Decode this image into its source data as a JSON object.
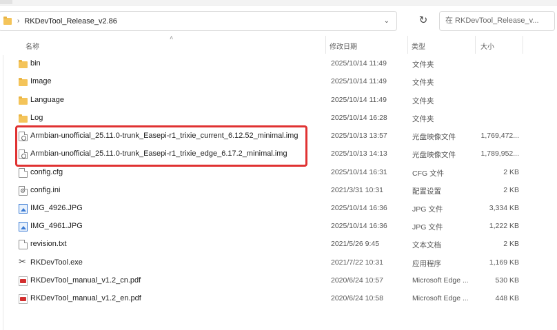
{
  "address": {
    "path": "RKDevTool_Release_v2.86",
    "search_placeholder": "在 RKDevTool_Release_v..."
  },
  "columns": {
    "name": "名称",
    "date": "修改日期",
    "type": "类型",
    "size": "大小"
  },
  "files": [
    {
      "name": "bin",
      "date": "2025/10/14 11:49",
      "type": "文件夹",
      "size": "",
      "icon": "folder-icon"
    },
    {
      "name": "Image",
      "date": "2025/10/14 11:49",
      "type": "文件夹",
      "size": "",
      "icon": "folder-icon"
    },
    {
      "name": "Language",
      "date": "2025/10/14 11:49",
      "type": "文件夹",
      "size": "",
      "icon": "folder-icon"
    },
    {
      "name": "Log",
      "date": "2025/10/14 16:28",
      "type": "文件夹",
      "size": "",
      "icon": "folder-icon"
    },
    {
      "name": "Armbian-unofficial_25.11.0-trunk_Easepi-r1_trixie_current_6.12.52_minimal.img",
      "date": "2025/10/13 13:57",
      "type": "光盘映像文件",
      "size": "1,769,472...",
      "icon": "disk-image-icon"
    },
    {
      "name": "Armbian-unofficial_25.11.0-trunk_Easepi-r1_trixie_edge_6.17.2_minimal.img",
      "date": "2025/10/13 14:13",
      "type": "光盘映像文件",
      "size": "1,789,952...",
      "icon": "disk-image-icon"
    },
    {
      "name": "config.cfg",
      "date": "2025/10/14 16:31",
      "type": "CFG 文件",
      "size": "2 KB",
      "icon": "file-icon"
    },
    {
      "name": "config.ini",
      "date": "2021/3/31 10:31",
      "type": "配置设置",
      "size": "2 KB",
      "icon": "settings-file-icon"
    },
    {
      "name": "IMG_4926.JPG",
      "date": "2025/10/14 16:36",
      "type": "JPG 文件",
      "size": "3,334 KB",
      "icon": "image-file-icon"
    },
    {
      "name": "IMG_4961.JPG",
      "date": "2025/10/14 16:36",
      "type": "JPG 文件",
      "size": "1,222 KB",
      "icon": "image-file-icon"
    },
    {
      "name": "revision.txt",
      "date": "2021/5/26 9:45",
      "type": "文本文档",
      "size": "2 KB",
      "icon": "text-file-icon"
    },
    {
      "name": "RKDevTool.exe",
      "date": "2021/7/22 10:31",
      "type": "应用程序",
      "size": "1,169 KB",
      "icon": "application-icon"
    },
    {
      "name": "RKDevTool_manual_v1.2_cn.pdf",
      "date": "2020/6/24 10:57",
      "type": "Microsoft Edge ...",
      "size": "530 KB",
      "icon": "pdf-icon"
    },
    {
      "name": "RKDevTool_manual_v1.2_en.pdf",
      "date": "2020/6/24 10:58",
      "type": "Microsoft Edge ...",
      "size": "448 KB",
      "icon": "pdf-icon"
    }
  ],
  "colors": {
    "highlight": "#e03232",
    "folder": "#f4c45a"
  }
}
